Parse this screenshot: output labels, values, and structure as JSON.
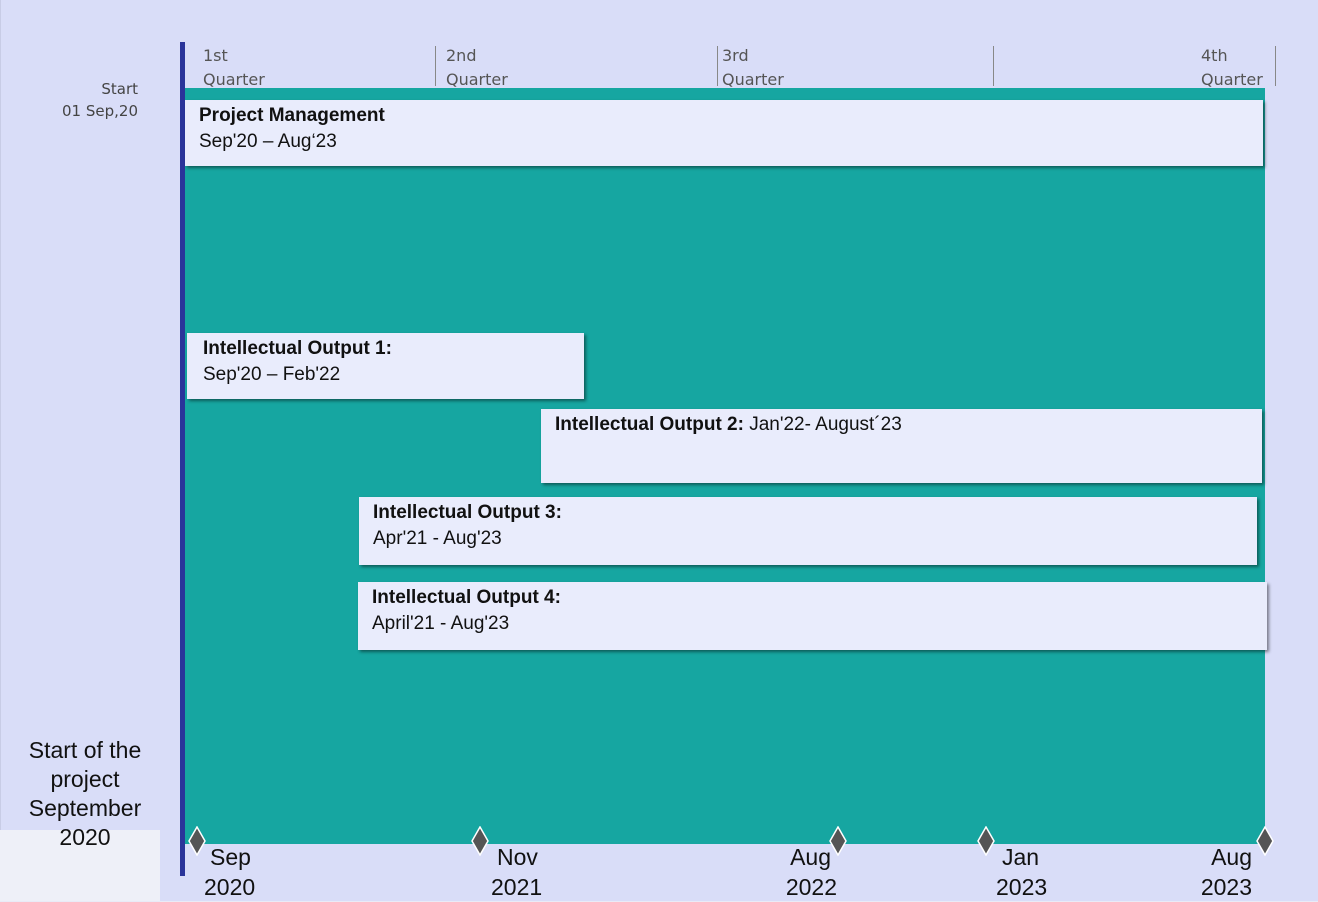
{
  "timeline": {
    "start_label": [
      "Start",
      "01 Sep,20"
    ],
    "quarters": [
      {
        "line1": "1st",
        "line2": "Quarter"
      },
      {
        "line1": "2nd",
        "line2": "Quarter"
      },
      {
        "line1": "3rd",
        "line2": "Quarter"
      },
      {
        "line1": "4th",
        "line2": "Quarter"
      }
    ],
    "project_start": [
      "Start of the",
      "project",
      "September",
      "2020"
    ],
    "tasks": [
      {
        "title": "Project Management",
        "dates": "Sep'20 – Aug‘23"
      },
      {
        "title": "Intellectual Output 1:",
        "dates": "Sep'20 – Feb'22"
      },
      {
        "title": "Intellectual Output 2:",
        "dates": " Jan'22- August´23"
      },
      {
        "title": "Intellectual Output 3:",
        "dates": "Apr'21 - Aug'23"
      },
      {
        "title": "Intellectual Output 4:",
        "dates": "April'21 - Aug'23"
      }
    ],
    "milestones": [
      {
        "month": "Sep",
        "year": "2020"
      },
      {
        "month": "Nov",
        "year": "2021"
      },
      {
        "month": "Aug",
        "year": "2022"
      },
      {
        "month": "Jan",
        "year": "2023"
      },
      {
        "month": "Aug",
        "year": "2023"
      }
    ],
    "colors": {
      "background": "#d9ddf8",
      "timeline_fill": "#16a6a1",
      "axis_bar": "#2a349a",
      "task_fill": "#e9ecfc",
      "milestone": "#555555"
    }
  }
}
